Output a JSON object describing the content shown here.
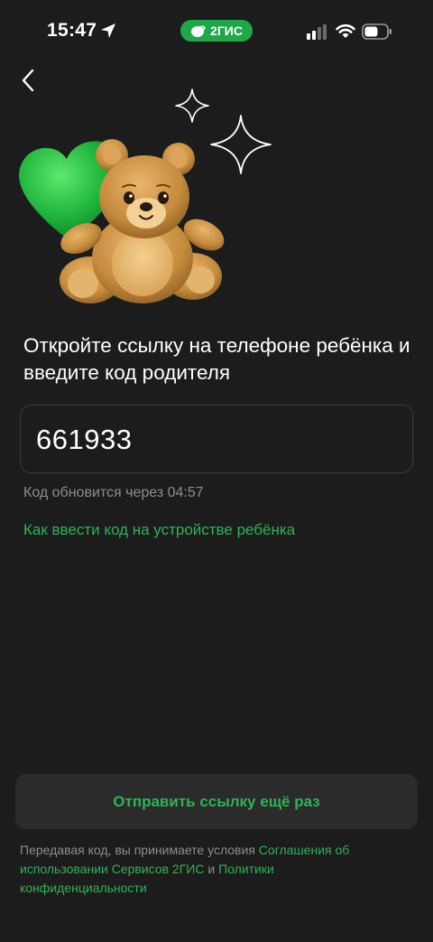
{
  "status_bar": {
    "time": "15:47",
    "brand": "2ГИС",
    "icons": [
      "location-arrow-icon",
      "signal-icon",
      "wifi-icon",
      "battery-icon"
    ]
  },
  "nav": {
    "back_icon": "chevron-left-icon"
  },
  "illustration": {
    "name": "teddy-bear-with-green-heart",
    "sparkles": 2
  },
  "heading": "Откройте ссылку на телефоне ребёнка и введите код родителя",
  "code": {
    "value": "661933"
  },
  "timer_text": "Код обновится через 04:57",
  "help_link": "Как ввести код на устройстве ребёнка",
  "resend_button": "Отправить ссылку ещё раз",
  "legal": {
    "prefix": "Передавая код, вы принимаете условия ",
    "link1": "Соглашения об использовании Сервисов 2ГИС",
    "middle": " и ",
    "link2": "Политики конфиденциальности"
  },
  "colors": {
    "background": "#1c1c1c",
    "accent": "#2fb356",
    "brand_pill": "#1ea84a",
    "muted_text": "#8e8e8e",
    "button_bg": "#2b2b2b"
  }
}
